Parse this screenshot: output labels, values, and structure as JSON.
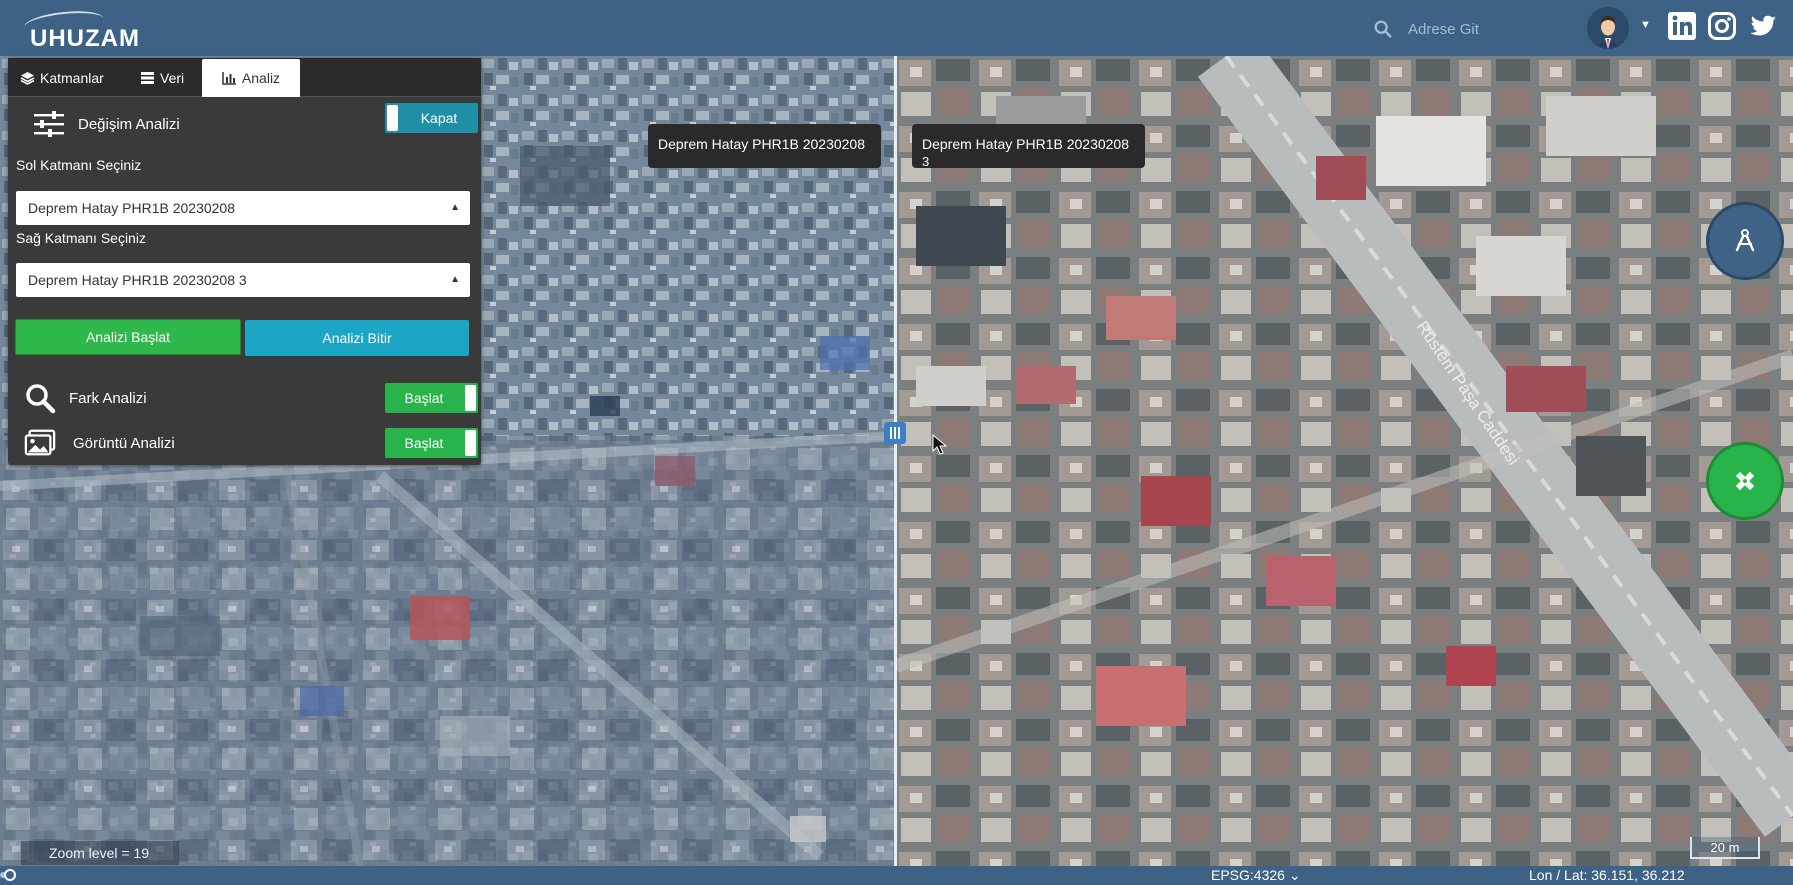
{
  "app": {
    "logo_text": "UHUZAM",
    "search_placeholder": "Adrese Git"
  },
  "icons": {
    "search": "search-icon",
    "avatar": "user-avatar",
    "linkedin": "linkedin-icon",
    "instagram": "instagram-icon",
    "twitter": "twitter-icon"
  },
  "panel": {
    "tabs": [
      {
        "label": "Katmanlar",
        "icon": "layers-icon"
      },
      {
        "label": "Veri",
        "icon": "list-icon"
      },
      {
        "label": "Analiz",
        "icon": "bar-chart-icon",
        "active": true
      }
    ],
    "change_analysis": {
      "title": "Değişim Analizi",
      "toggle_label": "Kapat"
    },
    "left_layer_label": "Sol Katmanı Seçiniz",
    "left_layer_value": "Deprem Hatay PHR1B 20230208",
    "right_layer_label": "Sağ Katmanı Seçiniz",
    "right_layer_value": "Deprem Hatay PHR1B 20230208 3",
    "start_button": "Analizi Başlat",
    "stop_button": "Analizi Bitir",
    "diff_analysis": {
      "label": "Fark Analizi",
      "toggle_label": "Başlat"
    },
    "image_analysis": {
      "label": "Görüntü Analizi",
      "toggle_label": "Başlat"
    }
  },
  "map": {
    "left_layer_tag": "Deprem Hatay PHR1B 20230208",
    "right_layer_tag_line1": "Deprem Hatay PHR1B 20230208",
    "right_layer_tag_line2": "3",
    "street_name": "Rüstem Paşa Caddesi",
    "zoom_level_text": "Zoom level = 19",
    "scale_text": "20 m"
  },
  "status": {
    "epsg": "EPSG:4326",
    "lonlat": "Lon / Lat: 36.151, 36.212"
  },
  "colors": {
    "topbar": "#3e6286",
    "panel": "#3a3a3a",
    "start_green": "#2fb84b",
    "stop_cyan": "#1aa6c4"
  }
}
